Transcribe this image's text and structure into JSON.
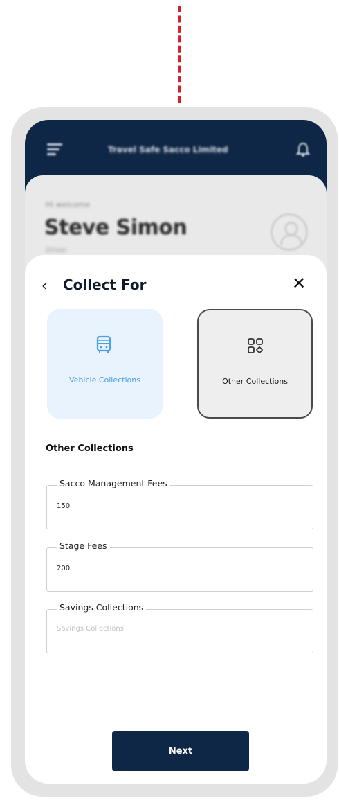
{
  "header": {
    "title": "Travel Safe Sacco Limited",
    "menu_icon": "menu-icon",
    "bell_icon": "bell-icon"
  },
  "background_card": {
    "welcome": "Hi welcome",
    "user_name": "Steve Simon",
    "sub_text": "Driver"
  },
  "sheet": {
    "title": "Collect For",
    "back_icon": "chevron-left-icon",
    "close_icon": "close-icon",
    "options": [
      {
        "label": "Vehicle Collections",
        "icon": "bus-icon",
        "selected": false
      },
      {
        "label": "Other Collections",
        "icon": "grid-icon",
        "selected": true
      }
    ],
    "section_title": "Other Collections",
    "fields": [
      {
        "label": "Sacco Management Fees",
        "value": "150",
        "placeholder": ""
      },
      {
        "label": "Stage Fees",
        "value": "200",
        "placeholder": ""
      },
      {
        "label": "Savings Collections",
        "value": "",
        "placeholder": "Savings Collections"
      }
    ],
    "next_label": "Next"
  },
  "colors": {
    "navy": "#0f2746",
    "accent_red": "#d41f2d",
    "vehicle_blue": "#4aa0e6",
    "vehicle_bg": "#e8f3fd"
  }
}
